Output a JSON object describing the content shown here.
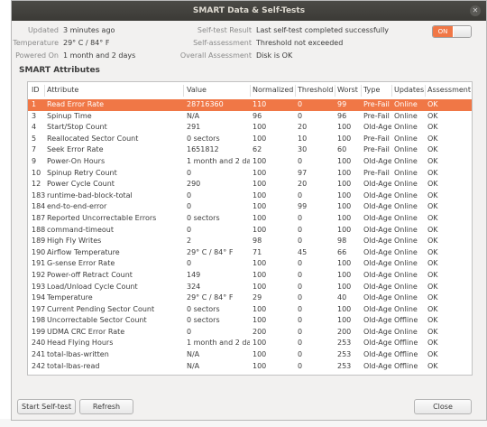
{
  "window": {
    "title": "SMART Data & Self-Tests"
  },
  "info": {
    "updated_label": "Updated",
    "updated_value": "3 minutes ago",
    "temperature_label": "Temperature",
    "temperature_value": "29° C / 84° F",
    "powered_on_label": "Powered On",
    "powered_on_value": "1 month and 2 days",
    "self_test_label": "Self-test Result",
    "self_test_value": "Last self-test completed successfully",
    "self_assessment_label": "Self-assessment",
    "self_assessment_value": "Threshold not exceeded",
    "overall_label": "Overall Assessment",
    "overall_value": "Disk is OK"
  },
  "toggle": {
    "label": "ON",
    "state": "on",
    "accent": "#f07746"
  },
  "attributes": {
    "title": "SMART Attributes",
    "columns": [
      "ID",
      "Attribute",
      "Value",
      "Normalized",
      "Threshold",
      "Worst",
      "Type",
      "Updates",
      "Assessment"
    ],
    "selected_index": 0,
    "rows": [
      {
        "id": "1",
        "name": "Read Error Rate",
        "value": "28716360",
        "normalized": "110",
        "threshold": "0",
        "worst": "99",
        "type": "Pre-Fail",
        "updates": "Online",
        "assessment": "OK"
      },
      {
        "id": "3",
        "name": "Spinup Time",
        "value": "N/A",
        "normalized": "96",
        "threshold": "0",
        "worst": "96",
        "type": "Pre-Fail",
        "updates": "Online",
        "assessment": "OK"
      },
      {
        "id": "4",
        "name": "Start/Stop Count",
        "value": "291",
        "normalized": "100",
        "threshold": "20",
        "worst": "100",
        "type": "Old-Age",
        "updates": "Online",
        "assessment": "OK"
      },
      {
        "id": "5",
        "name": "Reallocated Sector Count",
        "value": "0 sectors",
        "normalized": "100",
        "threshold": "10",
        "worst": "100",
        "type": "Pre-Fail",
        "updates": "Online",
        "assessment": "OK"
      },
      {
        "id": "7",
        "name": "Seek Error Rate",
        "value": "1651812",
        "normalized": "62",
        "threshold": "30",
        "worst": "60",
        "type": "Pre-Fail",
        "updates": "Online",
        "assessment": "OK"
      },
      {
        "id": "9",
        "name": "Power-On Hours",
        "value": "1 month and 2 days",
        "normalized": "100",
        "threshold": "0",
        "worst": "100",
        "type": "Old-Age",
        "updates": "Online",
        "assessment": "OK"
      },
      {
        "id": "10",
        "name": "Spinup Retry Count",
        "value": "0",
        "normalized": "100",
        "threshold": "97",
        "worst": "100",
        "type": "Pre-Fail",
        "updates": "Online",
        "assessment": "OK"
      },
      {
        "id": "12",
        "name": "Power Cycle Count",
        "value": "290",
        "normalized": "100",
        "threshold": "20",
        "worst": "100",
        "type": "Old-Age",
        "updates": "Online",
        "assessment": "OK"
      },
      {
        "id": "183",
        "name": "runtime-bad-block-total",
        "value": "0",
        "normalized": "100",
        "threshold": "0",
        "worst": "100",
        "type": "Old-Age",
        "updates": "Online",
        "assessment": "OK"
      },
      {
        "id": "184",
        "name": "end-to-end-error",
        "value": "0",
        "normalized": "100",
        "threshold": "99",
        "worst": "100",
        "type": "Old-Age",
        "updates": "Online",
        "assessment": "OK"
      },
      {
        "id": "187",
        "name": "Reported Uncorrectable Errors",
        "value": "0 sectors",
        "normalized": "100",
        "threshold": "0",
        "worst": "100",
        "type": "Old-Age",
        "updates": "Online",
        "assessment": "OK"
      },
      {
        "id": "188",
        "name": "command-timeout",
        "value": "0",
        "normalized": "100",
        "threshold": "0",
        "worst": "100",
        "type": "Old-Age",
        "updates": "Online",
        "assessment": "OK"
      },
      {
        "id": "189",
        "name": "High Fly Writes",
        "value": "2",
        "normalized": "98",
        "threshold": "0",
        "worst": "98",
        "type": "Old-Age",
        "updates": "Online",
        "assessment": "OK"
      },
      {
        "id": "190",
        "name": "Airflow Temperature",
        "value": "29° C / 84° F",
        "normalized": "71",
        "threshold": "45",
        "worst": "66",
        "type": "Old-Age",
        "updates": "Online",
        "assessment": "OK"
      },
      {
        "id": "191",
        "name": "G-sense Error Rate",
        "value": "0",
        "normalized": "100",
        "threshold": "0",
        "worst": "100",
        "type": "Old-Age",
        "updates": "Online",
        "assessment": "OK"
      },
      {
        "id": "192",
        "name": "Power-off Retract Count",
        "value": "149",
        "normalized": "100",
        "threshold": "0",
        "worst": "100",
        "type": "Old-Age",
        "updates": "Online",
        "assessment": "OK"
      },
      {
        "id": "193",
        "name": "Load/Unload Cycle Count",
        "value": "324",
        "normalized": "100",
        "threshold": "0",
        "worst": "100",
        "type": "Old-Age",
        "updates": "Online",
        "assessment": "OK"
      },
      {
        "id": "194",
        "name": "Temperature",
        "value": "29° C / 84° F",
        "normalized": "29",
        "threshold": "0",
        "worst": "40",
        "type": "Old-Age",
        "updates": "Online",
        "assessment": "OK"
      },
      {
        "id": "197",
        "name": "Current Pending Sector Count",
        "value": "0 sectors",
        "normalized": "100",
        "threshold": "0",
        "worst": "100",
        "type": "Old-Age",
        "updates": "Online",
        "assessment": "OK"
      },
      {
        "id": "198",
        "name": "Uncorrectable Sector Count",
        "value": "0 sectors",
        "normalized": "100",
        "threshold": "0",
        "worst": "100",
        "type": "Old-Age",
        "updates": "Offline",
        "assessment": "OK"
      },
      {
        "id": "199",
        "name": "UDMA CRC Error Rate",
        "value": "0",
        "normalized": "200",
        "threshold": "0",
        "worst": "200",
        "type": "Old-Age",
        "updates": "Online",
        "assessment": "OK"
      },
      {
        "id": "240",
        "name": "Head Flying Hours",
        "value": "1 month and 2 days",
        "normalized": "100",
        "threshold": "0",
        "worst": "253",
        "type": "Old-Age",
        "updates": "Offline",
        "assessment": "OK"
      },
      {
        "id": "241",
        "name": "total-lbas-written",
        "value": "N/A",
        "normalized": "100",
        "threshold": "0",
        "worst": "253",
        "type": "Old-Age",
        "updates": "Offline",
        "assessment": "OK"
      },
      {
        "id": "242",
        "name": "total-lbas-read",
        "value": "N/A",
        "normalized": "100",
        "threshold": "0",
        "worst": "253",
        "type": "Old-Age",
        "updates": "Offline",
        "assessment": "OK"
      }
    ]
  },
  "buttons": {
    "start_self_test": "Start Self-test",
    "refresh": "Refresh",
    "close": "Close"
  },
  "colors": {
    "selection": "#f07746",
    "titlebar": "#3b3a36"
  }
}
